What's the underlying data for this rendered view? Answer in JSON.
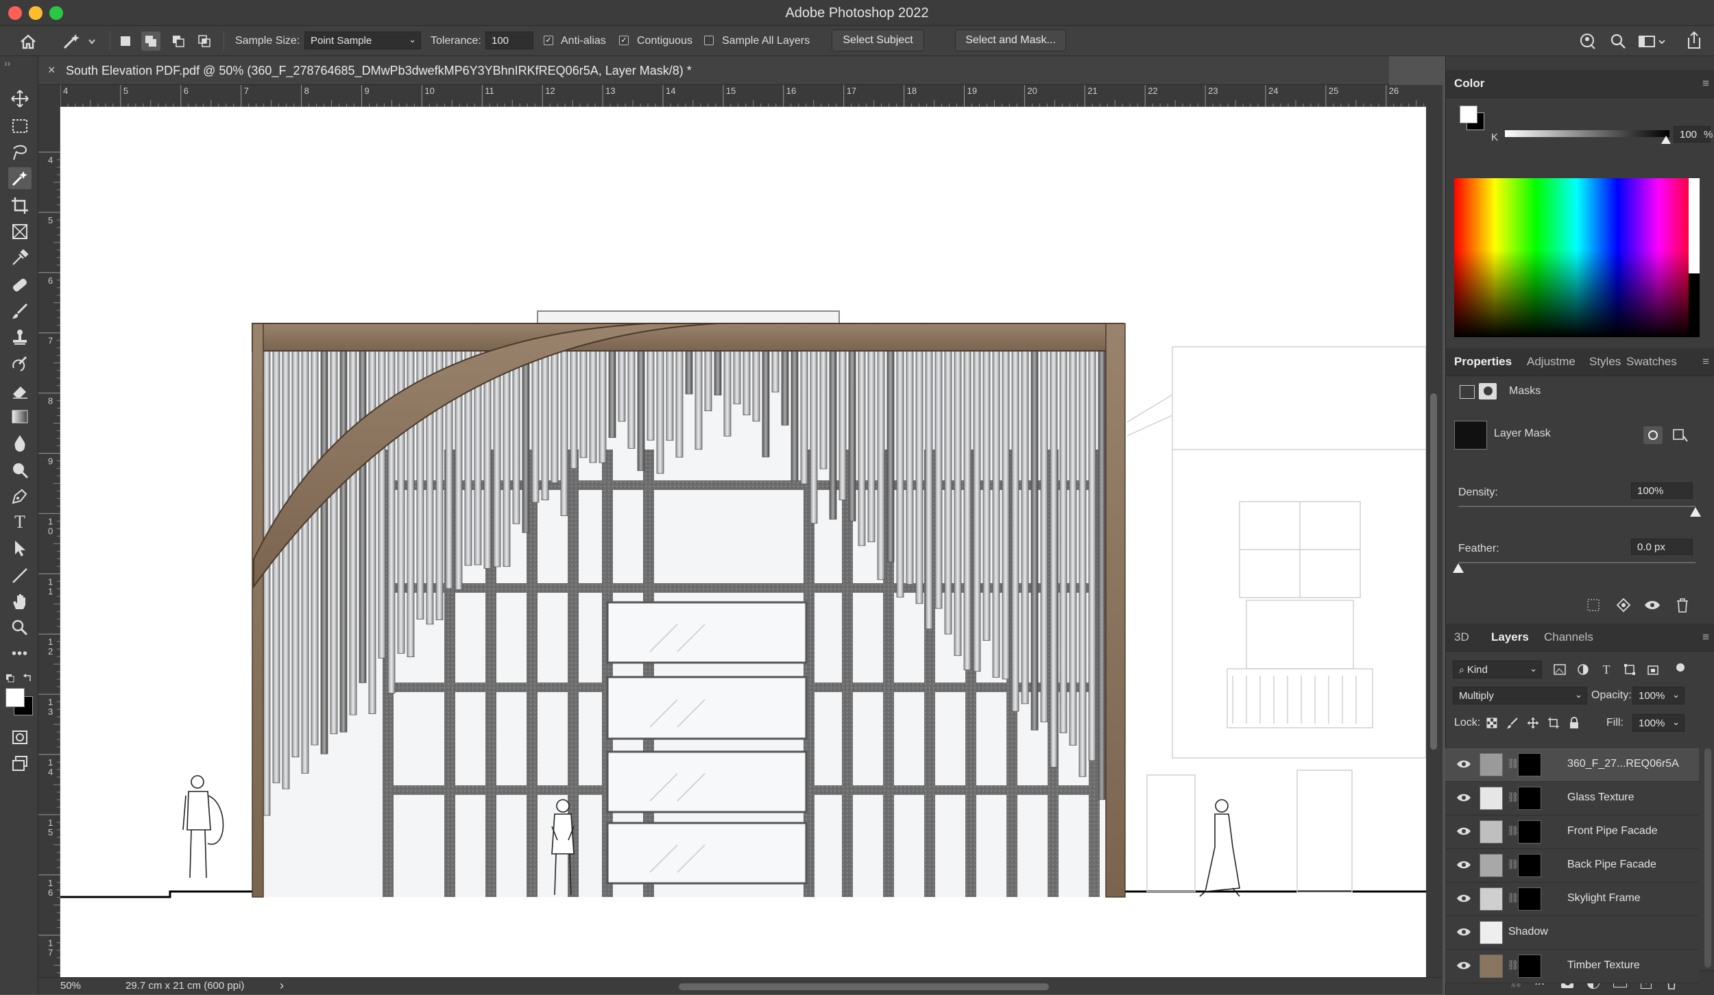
{
  "app": {
    "title": "Adobe Photoshop 2022"
  },
  "options_bar": {
    "sample_size_label": "Sample Size:",
    "sample_size_value": "Point Sample",
    "tolerance_label": "Tolerance:",
    "tolerance_value": "100",
    "anti_alias_label": "Anti-alias",
    "anti_alias_checked": true,
    "contiguous_label": "Contiguous",
    "contiguous_checked": true,
    "sample_all_layers_label": "Sample All Layers",
    "sample_all_layers_checked": false,
    "select_subject_label": "Select Subject",
    "select_and_mask_label": "Select and Mask..."
  },
  "document": {
    "tab_title": "South Elevation PDF.pdf @ 50% (360_F_278764685_DMwPb3dwefkMP6Y3YBhnIRKfREQ06r5A, Layer Mask/8) *",
    "close_glyph": "×"
  },
  "rulers": {
    "horizontal": [
      "4",
      "5",
      "6",
      "7",
      "8",
      "9",
      "10",
      "11",
      "12",
      "13",
      "14",
      "15",
      "16",
      "17",
      "18",
      "19",
      "20",
      "21",
      "22",
      "23",
      "24",
      "25",
      "26"
    ],
    "vertical": [
      "4",
      "5",
      "6",
      "7",
      "8",
      "9",
      "1\n0",
      "1\n1",
      "1\n2",
      "1\n3",
      "1\n4",
      "1\n5",
      "1\n6",
      "1\n7"
    ]
  },
  "status_bar": {
    "zoom": "50%",
    "doc_size": "29.7 cm x 21 cm (600 ppi)",
    "arrow": "›"
  },
  "color_panel": {
    "title": "Color",
    "channel_label": "K",
    "k_value": "100",
    "percent": "%"
  },
  "properties_panel": {
    "tabs": [
      "Properties",
      "Adjustme",
      "Styles",
      "Swatches"
    ],
    "active_tab": "Properties",
    "section": "Masks",
    "mask_label": "Layer Mask",
    "density_label": "Density:",
    "density_value": "100%",
    "density_level": 1.0,
    "feather_label": "Feather:",
    "feather_value": "0.0 px",
    "feather_level": 0.0
  },
  "layers_panel": {
    "tabs": [
      "3D",
      "Layers",
      "Channels"
    ],
    "active_tab": "Layers",
    "filter_value": "Kind",
    "blend_mode": "Multiply",
    "opacity_label": "Opacity:",
    "opacity_value": "100%",
    "lock_label": "Lock:",
    "fill_label": "Fill:",
    "fill_value": "100%",
    "layers": [
      {
        "name": "360_F_27...REQ06r5A",
        "selected": true,
        "has_mask": true
      },
      {
        "name": "Glass Texture",
        "selected": false,
        "has_mask": true
      },
      {
        "name": "Front Pipe Facade",
        "selected": false,
        "has_mask": true
      },
      {
        "name": "Back Pipe Facade",
        "selected": false,
        "has_mask": true
      },
      {
        "name": "Skylight Frame",
        "selected": false,
        "has_mask": true
      },
      {
        "name": "Shadow",
        "selected": false,
        "has_mask": false
      },
      {
        "name": "Timber Texture",
        "selected": false,
        "has_mask": true
      }
    ]
  },
  "colors": {
    "foreground": "#ffffff",
    "background": "#000000",
    "timber": "#8a7560",
    "frame": "#6a6a6a"
  },
  "icons": {
    "home": "home-icon",
    "magic_wand": "magic-wand-icon",
    "search": "search-icon"
  }
}
